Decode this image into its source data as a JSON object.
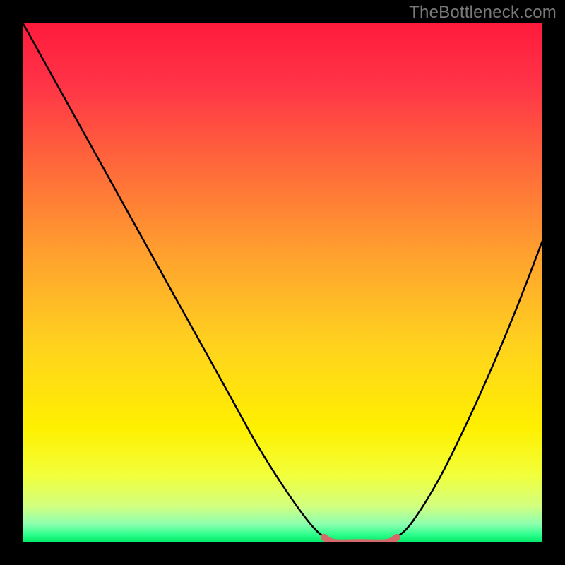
{
  "watermark": "TheBottleneck.com",
  "chart_data": {
    "type": "line",
    "title": "",
    "xlabel": "",
    "ylabel": "",
    "xlim": [
      0,
      100
    ],
    "ylim": [
      0,
      100
    ],
    "grid": false,
    "legend": false,
    "series": [
      {
        "name": "bottleneck-curve",
        "x": [
          0,
          5,
          10,
          15,
          20,
          25,
          30,
          35,
          40,
          45,
          50,
          55,
          58,
          60,
          65,
          70,
          72,
          75,
          80,
          85,
          90,
          95,
          100
        ],
        "values": [
          100,
          91,
          82,
          73,
          64,
          55,
          46,
          37,
          28,
          19,
          11,
          4,
          1,
          0,
          0,
          0,
          1,
          4,
          12,
          22,
          33,
          45,
          58
        ]
      },
      {
        "name": "optimal-range-marker",
        "x": [
          58,
          60,
          65,
          70,
          72
        ],
        "values": [
          1,
          0,
          0,
          0,
          1
        ]
      }
    ],
    "gradient_stops": [
      {
        "pos": 0.0,
        "color": "#ff1a3c"
      },
      {
        "pos": 0.12,
        "color": "#ff3447"
      },
      {
        "pos": 0.28,
        "color": "#ff6a3a"
      },
      {
        "pos": 0.45,
        "color": "#ffa22e"
      },
      {
        "pos": 0.62,
        "color": "#ffd21e"
      },
      {
        "pos": 0.78,
        "color": "#fff000"
      },
      {
        "pos": 0.87,
        "color": "#f2ff3a"
      },
      {
        "pos": 0.93,
        "color": "#d2ff80"
      },
      {
        "pos": 0.965,
        "color": "#8cffb0"
      },
      {
        "pos": 0.985,
        "color": "#2cff8c"
      },
      {
        "pos": 1.0,
        "color": "#00e865"
      }
    ]
  }
}
